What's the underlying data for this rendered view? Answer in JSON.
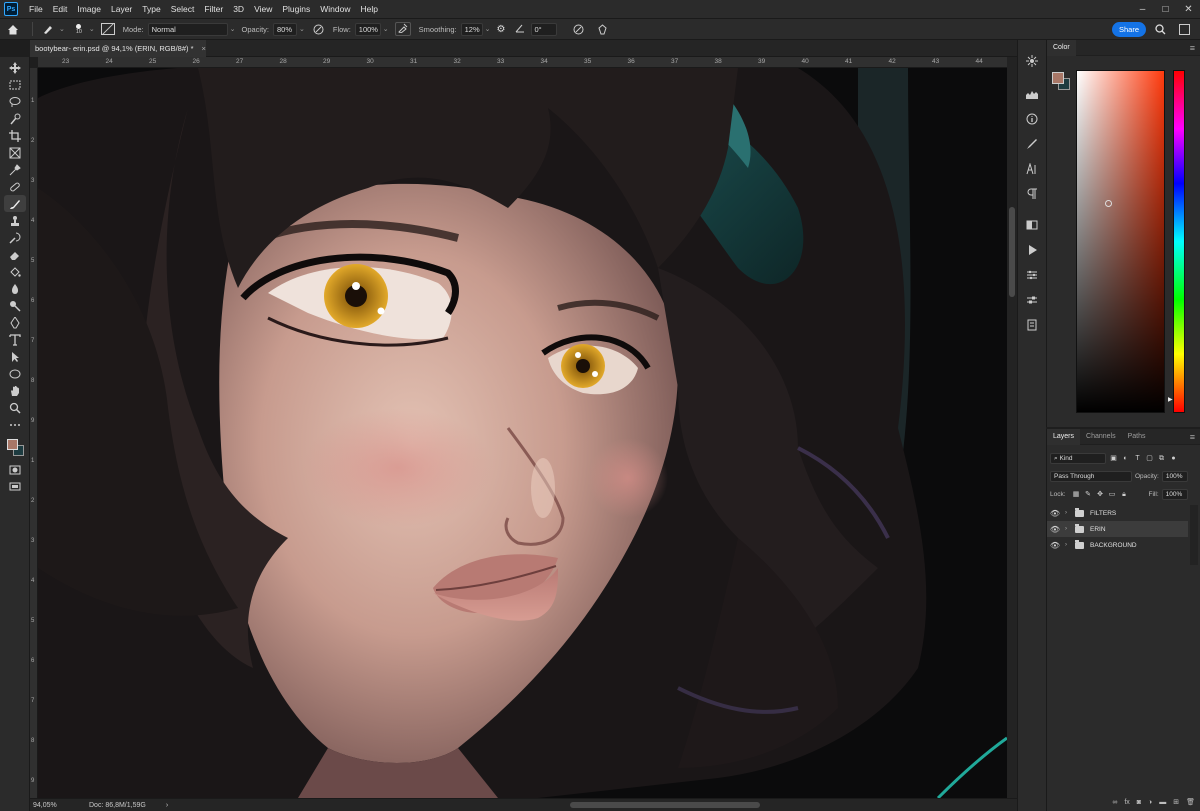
{
  "app": {
    "logo": "Ps",
    "menu": [
      "File",
      "Edit",
      "Image",
      "Layer",
      "Type",
      "Select",
      "Filter",
      "3D",
      "View",
      "Plugins",
      "Window",
      "Help"
    ]
  },
  "options": {
    "brush_size": "10",
    "mode_label": "Mode:",
    "mode_value": "Normal",
    "opacity_label": "Opacity:",
    "opacity_value": "80%",
    "flow_label": "Flow:",
    "flow_value": "100%",
    "smoothing_label": "Smoothing:",
    "smoothing_value": "12%",
    "angle_value": "0°",
    "share_label": "Share"
  },
  "document": {
    "tab_title": "bootybear- erin.psd @ 94,1% (ERIN, RGB/8#) *",
    "zoom": "94,05%",
    "doc_size": "Doc: 86,8M/1,59G"
  },
  "rulers": {
    "top": [
      "23",
      "24",
      "25",
      "26",
      "27",
      "28",
      "29",
      "30",
      "31",
      "32",
      "33",
      "34",
      "35",
      "36",
      "37",
      "38",
      "39",
      "40",
      "41",
      "42",
      "43",
      "44"
    ],
    "left": [
      "1",
      "2",
      "3",
      "4",
      "5",
      "6",
      "7",
      "8",
      "9",
      "1",
      "2",
      "3",
      "4",
      "5",
      "6",
      "7",
      "8",
      "9"
    ]
  },
  "colors": {
    "foreground": "#a87767",
    "background": "#1d3b40",
    "accent": "#1473e6"
  },
  "color_panel": {
    "tab": "Color"
  },
  "layers_panel": {
    "tabs": [
      "Layers",
      "Channels",
      "Paths"
    ],
    "filter_kind": "Kind",
    "blend_mode": "Pass Through",
    "opacity_label": "Opacity:",
    "opacity_value": "100%",
    "lock_label": "Lock:",
    "fill_label": "Fill:",
    "fill_value": "100%",
    "layers": [
      {
        "name": "FILTERS",
        "selected": false
      },
      {
        "name": "ERIN",
        "selected": true
      },
      {
        "name": "BACKGROUND",
        "selected": false
      }
    ],
    "footer_icons": [
      "link-icon",
      "fx-icon",
      "mask-icon",
      "adjustment-icon",
      "group-icon",
      "new-layer-icon",
      "trash-icon"
    ]
  },
  "toolbar": {
    "tools": [
      "move-tool",
      "marquee-tool",
      "lasso-tool",
      "quick-select-tool",
      "crop-tool",
      "frame-tool",
      "eyedropper-tool",
      "healing-tool",
      "brush-tool",
      "stamp-tool",
      "history-brush-tool",
      "eraser-tool",
      "bucket-tool",
      "blur-tool",
      "dodge-tool",
      "pen-tool",
      "type-tool",
      "path-select-tool",
      "shape-tool",
      "hand-tool",
      "zoom-tool",
      "more-tools"
    ]
  }
}
